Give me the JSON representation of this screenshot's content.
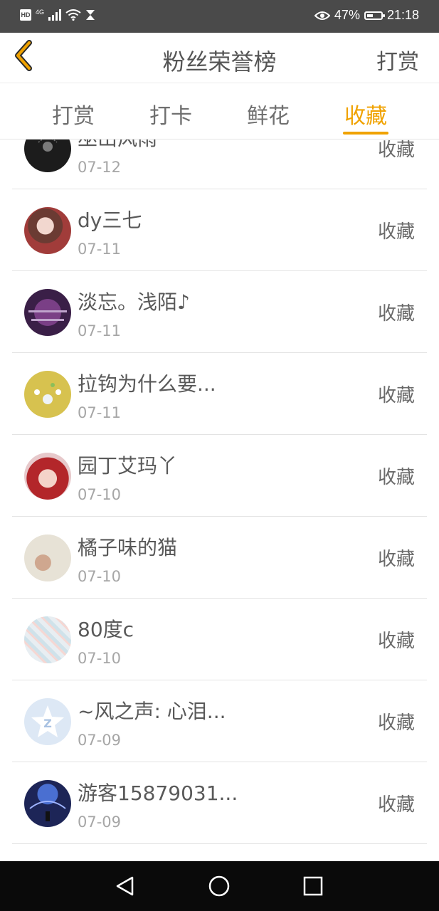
{
  "status_bar": {
    "hd": "HD",
    "network": "4G",
    "battery": "47%",
    "battery_level": 0.47,
    "time": "21:18"
  },
  "header": {
    "title": "粉丝荣誉榜",
    "action": "打赏"
  },
  "tabs": [
    {
      "label": "打赏",
      "active": false
    },
    {
      "label": "打卡",
      "active": false
    },
    {
      "label": "鲜花",
      "active": false
    },
    {
      "label": "收藏",
      "active": true
    }
  ],
  "list": [
    {
      "name": "巫山风雨",
      "date": "07-12",
      "action": "收藏"
    },
    {
      "name": "dy三七",
      "date": "07-11",
      "action": "收藏"
    },
    {
      "name": "淡忘。浅陌♪",
      "date": "07-11",
      "action": "收藏"
    },
    {
      "name": "拉钩为什么要...",
      "date": "07-11",
      "action": "收藏"
    },
    {
      "name": "园丁艾玛丫",
      "date": "07-10",
      "action": "收藏"
    },
    {
      "name": "橘子味的猫",
      "date": "07-10",
      "action": "收藏"
    },
    {
      "name": "80度c",
      "date": "07-10",
      "action": "收藏"
    },
    {
      "name": "~风之声: 心泪...",
      "date": "07-09",
      "action": "收藏"
    },
    {
      "name": "游客15879031...",
      "date": "07-09",
      "action": "收藏"
    }
  ],
  "colors": {
    "accent": "#f0a200",
    "status_bar": "#4a4a4a",
    "nav_bar": "#0a0a0a"
  },
  "icons": {
    "back": "chevron-left-icon",
    "nav_back": "triangle-back-icon",
    "nav_home": "circle-home-icon",
    "nav_recent": "square-recent-icon"
  }
}
